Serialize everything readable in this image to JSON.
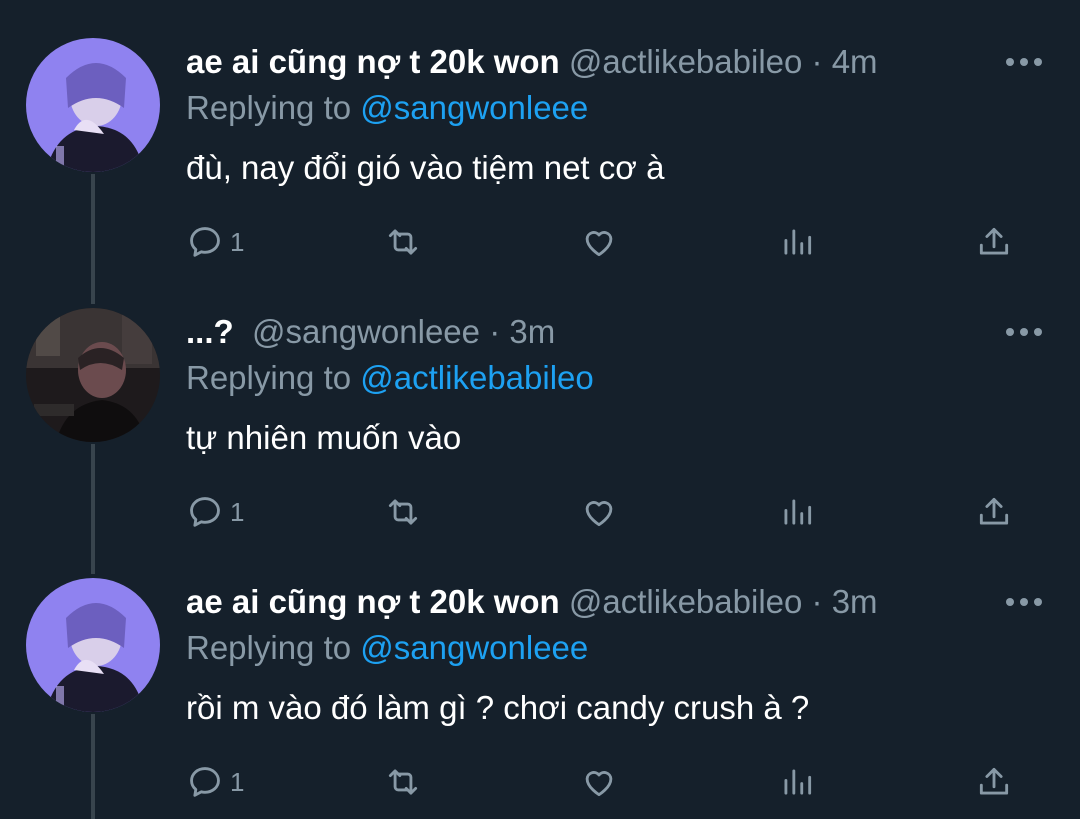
{
  "colors": {
    "background": "#15202b",
    "secondary_text": "#8899a6",
    "link": "#1da1f2",
    "thread_line": "#38444d"
  },
  "tweets": [
    {
      "name": "ae ai cũng nợ t 20k won",
      "handle": "@actlikebabileo",
      "separator": "·",
      "time": "4m",
      "replying_prefix": "Replying to",
      "replying_to": "@sangwonleee",
      "text": "đù, nay đổi gió vào tiệm net cơ à",
      "reply_count": "1",
      "avatar": "purple-portrait"
    },
    {
      "name": "...?",
      "handle": "@sangwonleee",
      "separator": "·",
      "time": "3m",
      "replying_prefix": "Replying to",
      "replying_to": "@actlikebabileo",
      "text": "tự nhiên muốn vào",
      "reply_count": "1",
      "avatar": "dark-night-portrait"
    },
    {
      "name": "ae ai cũng nợ t 20k won",
      "handle": "@actlikebabileo",
      "separator": "·",
      "time": "3m",
      "replying_prefix": "Replying to",
      "replying_to": "@sangwonleee",
      "text": "rồi m vào đó làm gì ? chơi candy crush à ?",
      "reply_count": "1",
      "avatar": "purple-portrait"
    }
  ]
}
